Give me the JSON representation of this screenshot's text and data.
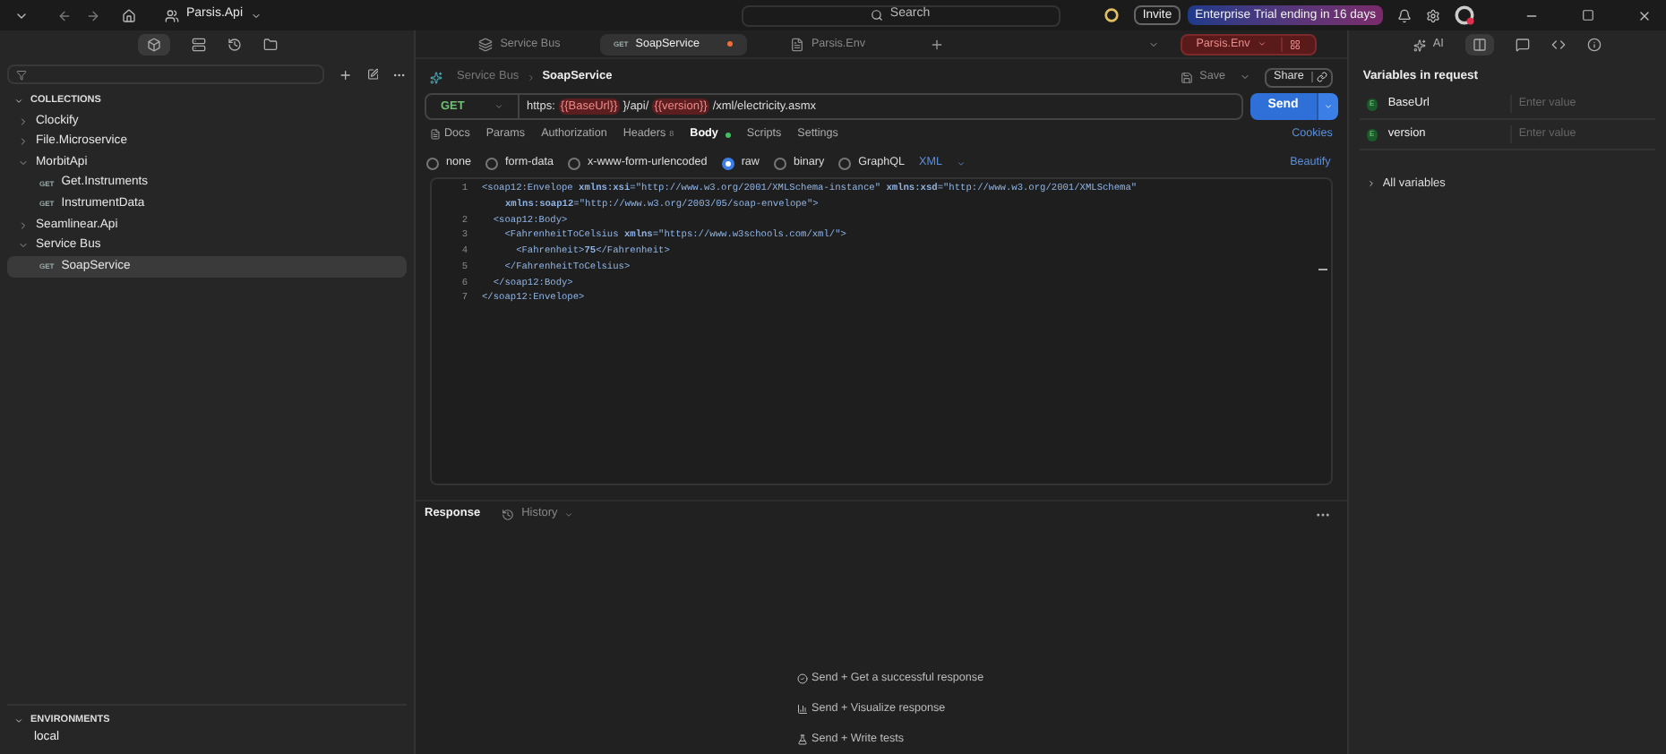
{
  "topbar": {
    "workspace": "Parsis.Api",
    "search": {
      "placeholder": "Search"
    },
    "invite": "Invite",
    "trial": "Enterprise Trial ending in 16 days"
  },
  "tabs": [
    {
      "kind": "collection",
      "label": "Service Bus",
      "selected": false,
      "unsaved": false
    },
    {
      "kind": "request",
      "method": "GET",
      "label": "SoapService",
      "selected": true,
      "unsaved": true
    },
    {
      "kind": "environment",
      "label": "Parsis.Env",
      "selected": false,
      "unsaved": false
    }
  ],
  "environment_selector": "Parsis.Env",
  "sidebar": {
    "section": "COLLECTIONS",
    "items": [
      {
        "kind": "folder",
        "label": "Clockify",
        "expanded": false,
        "selected": false
      },
      {
        "kind": "folder",
        "label": "File.Microservice",
        "expanded": false,
        "selected": false
      },
      {
        "kind": "folder",
        "label": "MorbitApi",
        "expanded": true,
        "selected": false,
        "children": [
          {
            "kind": "request",
            "method": "GET",
            "label": "Get.Instruments",
            "selected": false
          },
          {
            "kind": "request",
            "method": "GET",
            "label": "InstrumentData",
            "selected": false
          }
        ]
      },
      {
        "kind": "folder",
        "label": "Seamlinear.Api",
        "expanded": false,
        "selected": false
      },
      {
        "kind": "folder",
        "label": "Service Bus",
        "expanded": true,
        "selected": false,
        "children": [
          {
            "kind": "request",
            "method": "GET",
            "label": "SoapService",
            "selected": true
          }
        ]
      }
    ],
    "environments": {
      "section": "ENVIRONMENTS",
      "items": [
        "local"
      ]
    }
  },
  "request": {
    "breadcrumb": [
      "Service Bus",
      "SoapService"
    ],
    "save": "Save",
    "share": "Share",
    "method": "GET",
    "url": [
      {
        "kind": "text",
        "text": "https:"
      },
      {
        "kind": "var",
        "text": "{{BaseUrl}}"
      },
      {
        "kind": "text",
        "text": "}/api/"
      },
      {
        "kind": "var",
        "text": "{{version}}"
      },
      {
        "kind": "text",
        "text": "/xml/electricity.asmx"
      }
    ],
    "send": "Send",
    "tabs": [
      {
        "label": "Docs",
        "selected": false
      },
      {
        "label": "Params",
        "selected": false
      },
      {
        "label": "Authorization",
        "selected": false
      },
      {
        "label": "Headers",
        "count": "8",
        "selected": false
      },
      {
        "label": "Body",
        "dot": true,
        "selected": true
      },
      {
        "label": "Scripts",
        "selected": false
      },
      {
        "label": "Settings",
        "selected": false
      }
    ],
    "cookies": "Cookies",
    "body_types": [
      {
        "label": "none",
        "selected": false
      },
      {
        "label": "form-data",
        "selected": false
      },
      {
        "label": "x-www-form-urlencoded",
        "selected": false
      },
      {
        "label": "raw",
        "selected": true
      },
      {
        "label": "binary",
        "selected": false
      },
      {
        "label": "GraphQL",
        "selected": false
      }
    ],
    "format": "XML",
    "beautify": "Beautify",
    "code": [
      {
        "number": "1",
        "text": "<soap12:Envelope **xmlns:xsi**=\"http://www.w3.org/2001/XMLSchema-instance\" **xmlns:xsd**=\"http://www.w3.org/2001/XMLSchema\""
      },
      {
        "kind": "continuation",
        "text": "**xmlns:soap12**=\"http://www.w3.org/2003/05/soap-envelope\">"
      },
      {
        "number": "2",
        "text": "  <soap12:Body>"
      },
      {
        "number": "3",
        "text": "    <FahrenheitToCelsius **xmlns**=\"https://www.w3schools.com/xml/\">"
      },
      {
        "number": "4",
        "text": "      <Fahrenheit>**75**</Fahrenheit>"
      },
      {
        "number": "5",
        "text": "    </FahrenheitToCelsius>"
      },
      {
        "number": "6",
        "text": "  </soap12:Body>"
      },
      {
        "number": "7",
        "text": "</soap12:Envelope>"
      }
    ]
  },
  "response": {
    "title": "Response",
    "history": "History",
    "hints": [
      {
        "kind": "response",
        "text": "Send + Get a successful response"
      },
      {
        "kind": "visualize",
        "text": "Send + Visualize response"
      },
      {
        "kind": "tests",
        "text": "Send + Write tests"
      }
    ]
  },
  "right_panel": {
    "ai": "AI",
    "title": "Variables in request",
    "variables": [
      {
        "name": "BaseUrl",
        "badge": "E",
        "placeholder": "Enter value"
      },
      {
        "name": "version",
        "badge": "E",
        "placeholder": "Enter value"
      }
    ],
    "all_variables": "All variables"
  }
}
